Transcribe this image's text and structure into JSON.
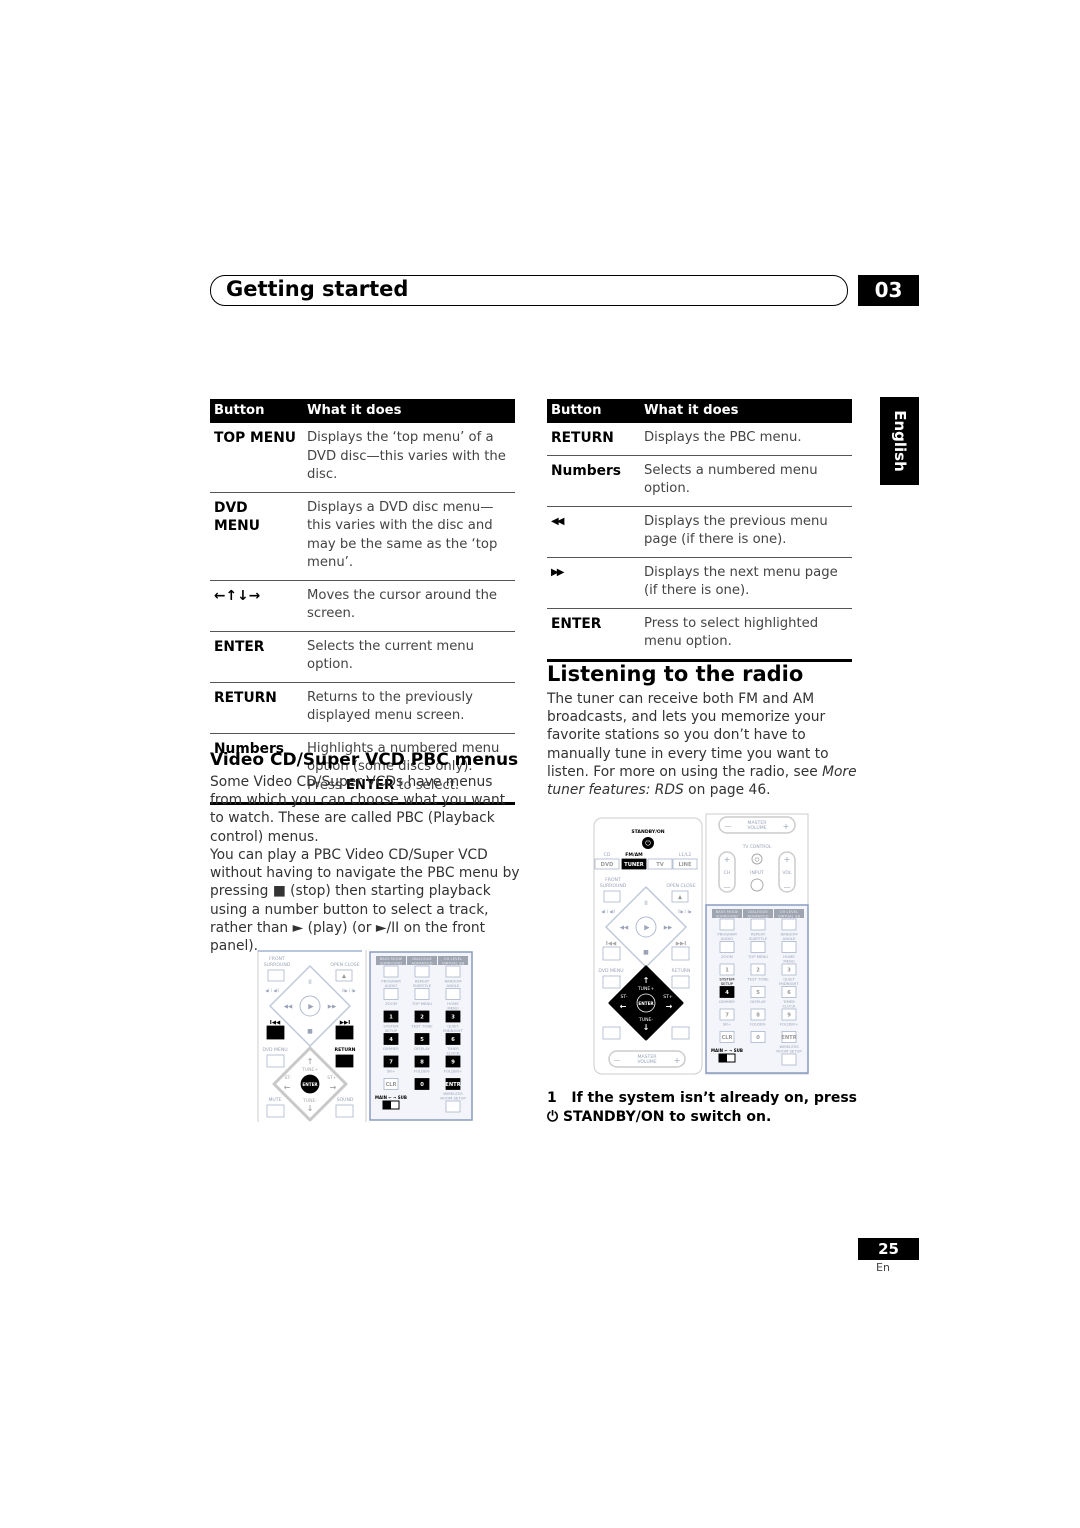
{
  "header": {
    "title": "Getting started",
    "chapter": "03"
  },
  "language_tab": "English",
  "left_table": {
    "headers": [
      "Button",
      "What it does"
    ],
    "rows": [
      {
        "button": "TOP MENU",
        "desc": "Displays the ‘top menu’ of a DVD disc—this varies with the disc."
      },
      {
        "button": "DVD MENU",
        "desc": "Displays a DVD disc menu—this varies with the disc and may be the same as the ‘top menu’."
      },
      {
        "button": "←↑↓→",
        "desc": "Moves the cursor around the screen."
      },
      {
        "button": "ENTER",
        "desc": "Selects the current menu option."
      },
      {
        "button": "RETURN",
        "desc": "Returns to the previously displayed menu screen."
      },
      {
        "button": "Numbers",
        "desc": "Highlights a numbered menu option (some discs only). Press ",
        "desc_bold": "ENTER",
        "desc_end": " to select."
      }
    ]
  },
  "right_table": {
    "headers": [
      "Button",
      "What it does"
    ],
    "rows": [
      {
        "button": "RETURN",
        "desc": "Displays the PBC menu."
      },
      {
        "button": "Numbers",
        "desc": "Selects a numbered menu option."
      },
      {
        "button": "◀◀",
        "desc": "Displays the previous menu page (if there is one)."
      },
      {
        "button": "▶▶",
        "desc": "Displays the next menu page (if there is one)."
      },
      {
        "button": "ENTER",
        "desc": "Press to select highlighted menu option."
      }
    ]
  },
  "pbc": {
    "title": "Video CD/Super VCD PBC menus",
    "para1": "Some Video CD/Super VCDs have menus from which you can choose what you want to watch. These are called PBC (Playback control) menus.",
    "para2a": "You can play a PBC Video CD/Super VCD without having to navigate the PBC menu by pressing ",
    "stop_glyph": "■",
    "para2b": " (stop) then starting playback using a number button to select a track, rather than ",
    "play_glyph": "►",
    "para2c": " (play) (or ",
    "playpause_glyph": "►/II",
    "para2d": " on the front panel)."
  },
  "radio": {
    "title": "Listening to the radio",
    "para_a": "The tuner can receive both FM and AM broadcasts, and lets you memorize your favorite stations so you don’t have to manually tune in every time you want to listen. For more on using the radio, see ",
    "para_link": "More tuner features: RDS",
    "para_b": " on page 46.",
    "step_num": "1",
    "step_a": "If the system isn’t already on, press",
    "step_icon": "power-icon",
    "step_b": "STANDBY/ON to switch on."
  },
  "remote": {
    "front_surround": [
      "FRONT",
      "SURROUND"
    ],
    "open_close": "OPEN CLOSE",
    "dvd_menu": "DVD MENU",
    "return": "RETURN",
    "enter": "ENTER",
    "tune_plus": "TUNE+",
    "tune_minus": "TUNE-",
    "st_minus": "ST-",
    "st_plus": "ST+",
    "mute": "MUTE",
    "sound": "SOUND",
    "main": "MAIN",
    "sub": "SUB",
    "standby": "STANDBY/ON",
    "inputs_top": [
      "CD",
      "FM/AM",
      "",
      "L1/L2"
    ],
    "inputs": [
      "DVD",
      "TUNER",
      "TV",
      "LINE"
    ],
    "master_volume": [
      "MASTER",
      "VOLUME"
    ],
    "tv_control": "TV CONTROL",
    "ch": "CH",
    "input": "INPUT",
    "vol": "VOL",
    "keypad": [
      {
        "label": "BASS MODE/SURROUND",
        "key": ""
      },
      {
        "label": "DIALOGUE/ADVANCED",
        "key": ""
      },
      {
        "label": "CH LEVEL/VIRTUAL SB",
        "key": ""
      },
      {
        "label": "PROGRAM/AUDIO",
        "key": ""
      },
      {
        "label": "REPEAT/SUBTITLE",
        "key": ""
      },
      {
        "label": "RANDOM/ANGLE",
        "key": ""
      },
      {
        "label": "ZOOM",
        "key": "1"
      },
      {
        "label": "TOP MENU",
        "key": "2"
      },
      {
        "label": "HOME/MENU",
        "key": "3"
      },
      {
        "label": "SYSTEM/SETUP",
        "key": "4"
      },
      {
        "label": "TEST TONE",
        "key": "5"
      },
      {
        "label": "QUIET/MIDNIGHT",
        "key": "6"
      },
      {
        "label": "DIMMER",
        "key": "7"
      },
      {
        "label": "DISPLAY",
        "key": "8"
      },
      {
        "label": "TIMER/CLOCK",
        "key": "9"
      },
      {
        "label": "SR+",
        "key": "CLR"
      },
      {
        "label": "FOLDER-",
        "key": "0"
      },
      {
        "label": "FOLDER+",
        "key": "ENTR"
      },
      {
        "label": "",
        "key": ""
      },
      {
        "label": "",
        "key": ""
      },
      {
        "label": "WIRELESS/ROOM SETUP",
        "key": ""
      }
    ]
  },
  "footer": {
    "page": "25",
    "lang": "En"
  }
}
